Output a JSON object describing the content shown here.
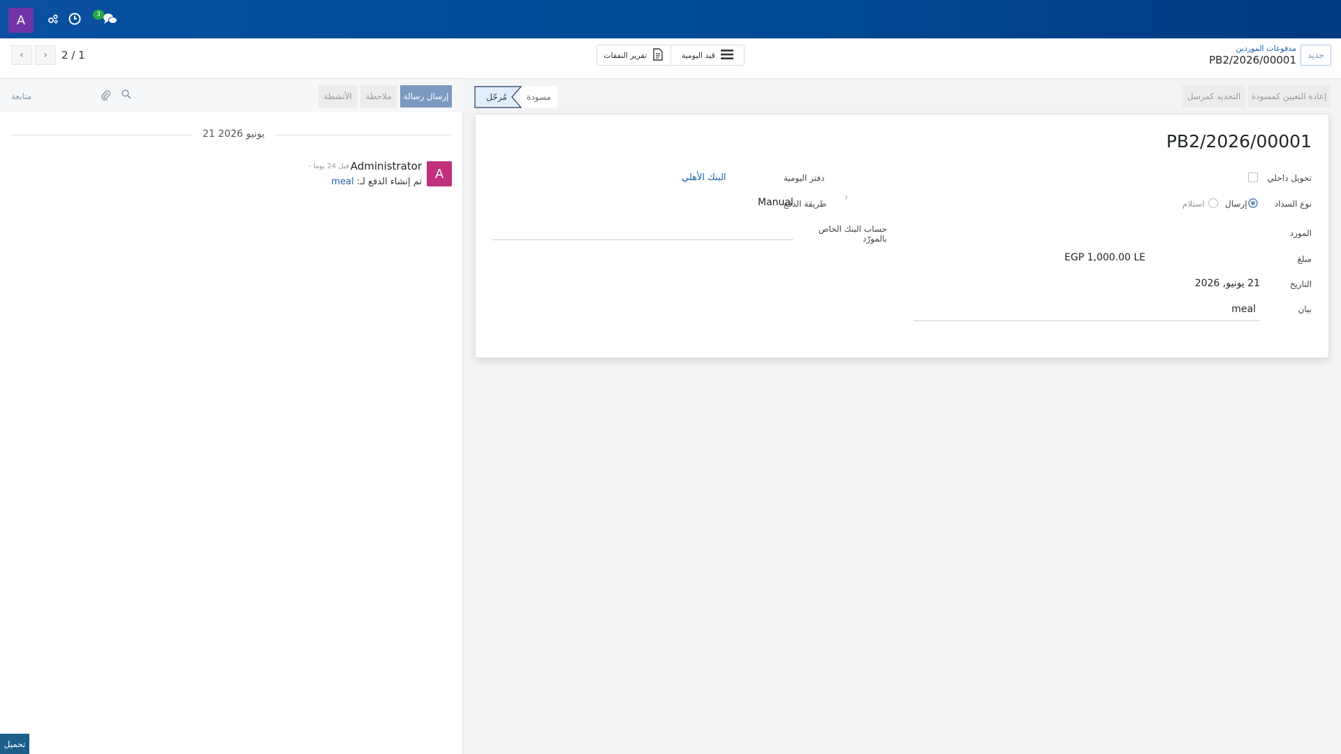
{
  "topbar": {
    "avatar_letter": "A",
    "icons": [
      "debug-icon",
      "clock-icon",
      "chat-icon"
    ],
    "chat_badge": "3"
  },
  "control_panel": {
    "pager": {
      "value": "2 / 1"
    },
    "smart_buttons": {
      "journal_items": "قيد اليومية",
      "expense_report": "تقرير النفقات"
    },
    "breadcrumb": {
      "parent": "مدفوعات الموردين",
      "current": "PB2/2026/00001"
    },
    "new_button": "جديد"
  },
  "chatter": {
    "send_message": "إرسال رسالة",
    "log_note": "ملاحظة",
    "activities": "الأنشطة",
    "follow": "متابعة",
    "date_separator": "21 يونيو 2026",
    "message": {
      "avatar_letter": "A",
      "author": "Administrator",
      "time": "- قبل 24 يوما",
      "body_prefix": "تم إنشاء الدفع لـ:",
      "body_link": "meal"
    },
    "load_button": "تحميل"
  },
  "header": {
    "reset_draft": "إعادة التعيين كمسودة",
    "mark_sent": "التحديد كمرسل",
    "status_draft": "مسودة",
    "status_posted": "مُرحّل"
  },
  "form": {
    "title": "PB2/2026/00001",
    "internal_transfer": {
      "label": "تحويل داخلي",
      "checked": false
    },
    "payment_type": {
      "label": "نوع السداد",
      "send": "إرسال",
      "receive": "استلام",
      "selected": "send"
    },
    "partner": {
      "label": "المورد",
      "value": ""
    },
    "amount": {
      "label": "مبلغ",
      "value": "EGP 1,000.00 LE"
    },
    "date": {
      "label": "التاريخ",
      "value": "21 يونيو, 2026"
    },
    "memo": {
      "label": "بيان",
      "value": "meal"
    },
    "journal": {
      "label": "دفتر اليومية",
      "value": "البنك الأهلي"
    },
    "payment_method": {
      "label": "طريقة الدفع",
      "help": "?",
      "value": "Manual"
    },
    "partner_bank": {
      "label": "حساب البنك الخاص بالمورّد",
      "value": ""
    }
  },
  "colors": {
    "topbar": "#004b96",
    "primary_button": "#7b9ac1",
    "link": "#1a5fa8",
    "chatter_avatar": "#c0307b",
    "user_avatar": "#6f35a8"
  }
}
